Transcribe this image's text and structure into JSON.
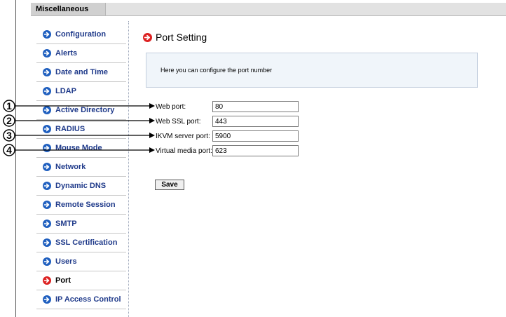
{
  "tabbar": {
    "active_tab": "Miscellaneous"
  },
  "sidebar": {
    "items": [
      {
        "label": "Configuration"
      },
      {
        "label": "Alerts"
      },
      {
        "label": "Date and Time"
      },
      {
        "label": "LDAP"
      },
      {
        "label": "Active Directory"
      },
      {
        "label": "RADIUS"
      },
      {
        "label": "Mouse Mode"
      },
      {
        "label": "Network"
      },
      {
        "label": "Dynamic DNS"
      },
      {
        "label": "Remote Session"
      },
      {
        "label": "SMTP"
      },
      {
        "label": "SSL Certification"
      },
      {
        "label": "Users"
      },
      {
        "label": "Port"
      },
      {
        "label": "IP Access Control"
      }
    ],
    "active_item": "Port"
  },
  "main": {
    "title": "Port Setting",
    "info_text": "Here you can configure the port number",
    "fields": [
      {
        "label": "Web port:",
        "value": "80"
      },
      {
        "label": "Web SSL port:",
        "value": "443"
      },
      {
        "label": "IKVM server port:",
        "value": "5900"
      },
      {
        "label": "Virtual media port:",
        "value": "623"
      }
    ],
    "save_label": "Save"
  },
  "callouts": [
    "1",
    "2",
    "3",
    "4"
  ],
  "colors": {
    "nav_text": "#1f3a8a",
    "icon_blue": "#1f5fbf",
    "icon_active_red": "#dd2222",
    "info_bg": "#f0f5fa"
  }
}
